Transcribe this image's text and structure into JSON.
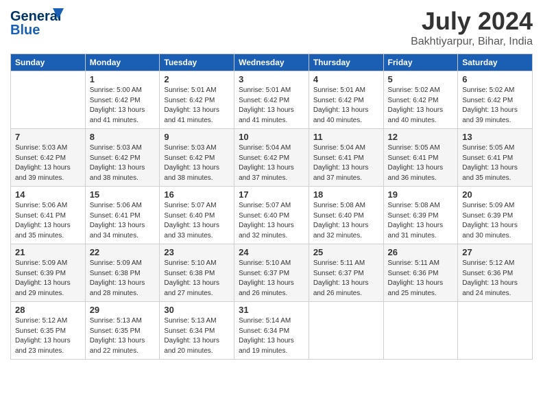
{
  "header": {
    "logo_line1": "General",
    "logo_line2": "Blue",
    "month_year": "July 2024",
    "location": "Bakhtiyarpur, Bihar, India"
  },
  "columns": [
    "Sunday",
    "Monday",
    "Tuesday",
    "Wednesday",
    "Thursday",
    "Friday",
    "Saturday"
  ],
  "weeks": [
    [
      {
        "day": "",
        "info": ""
      },
      {
        "day": "1",
        "info": "Sunrise: 5:00 AM\nSunset: 6:42 PM\nDaylight: 13 hours\nand 41 minutes."
      },
      {
        "day": "2",
        "info": "Sunrise: 5:01 AM\nSunset: 6:42 PM\nDaylight: 13 hours\nand 41 minutes."
      },
      {
        "day": "3",
        "info": "Sunrise: 5:01 AM\nSunset: 6:42 PM\nDaylight: 13 hours\nand 41 minutes."
      },
      {
        "day": "4",
        "info": "Sunrise: 5:01 AM\nSunset: 6:42 PM\nDaylight: 13 hours\nand 40 minutes."
      },
      {
        "day": "5",
        "info": "Sunrise: 5:02 AM\nSunset: 6:42 PM\nDaylight: 13 hours\nand 40 minutes."
      },
      {
        "day": "6",
        "info": "Sunrise: 5:02 AM\nSunset: 6:42 PM\nDaylight: 13 hours\nand 39 minutes."
      }
    ],
    [
      {
        "day": "7",
        "info": "Sunrise: 5:03 AM\nSunset: 6:42 PM\nDaylight: 13 hours\nand 39 minutes."
      },
      {
        "day": "8",
        "info": "Sunrise: 5:03 AM\nSunset: 6:42 PM\nDaylight: 13 hours\nand 38 minutes."
      },
      {
        "day": "9",
        "info": "Sunrise: 5:03 AM\nSunset: 6:42 PM\nDaylight: 13 hours\nand 38 minutes."
      },
      {
        "day": "10",
        "info": "Sunrise: 5:04 AM\nSunset: 6:42 PM\nDaylight: 13 hours\nand 37 minutes."
      },
      {
        "day": "11",
        "info": "Sunrise: 5:04 AM\nSunset: 6:41 PM\nDaylight: 13 hours\nand 37 minutes."
      },
      {
        "day": "12",
        "info": "Sunrise: 5:05 AM\nSunset: 6:41 PM\nDaylight: 13 hours\nand 36 minutes."
      },
      {
        "day": "13",
        "info": "Sunrise: 5:05 AM\nSunset: 6:41 PM\nDaylight: 13 hours\nand 35 minutes."
      }
    ],
    [
      {
        "day": "14",
        "info": "Sunrise: 5:06 AM\nSunset: 6:41 PM\nDaylight: 13 hours\nand 35 minutes."
      },
      {
        "day": "15",
        "info": "Sunrise: 5:06 AM\nSunset: 6:41 PM\nDaylight: 13 hours\nand 34 minutes."
      },
      {
        "day": "16",
        "info": "Sunrise: 5:07 AM\nSunset: 6:40 PM\nDaylight: 13 hours\nand 33 minutes."
      },
      {
        "day": "17",
        "info": "Sunrise: 5:07 AM\nSunset: 6:40 PM\nDaylight: 13 hours\nand 32 minutes."
      },
      {
        "day": "18",
        "info": "Sunrise: 5:08 AM\nSunset: 6:40 PM\nDaylight: 13 hours\nand 32 minutes."
      },
      {
        "day": "19",
        "info": "Sunrise: 5:08 AM\nSunset: 6:39 PM\nDaylight: 13 hours\nand 31 minutes."
      },
      {
        "day": "20",
        "info": "Sunrise: 5:09 AM\nSunset: 6:39 PM\nDaylight: 13 hours\nand 30 minutes."
      }
    ],
    [
      {
        "day": "21",
        "info": "Sunrise: 5:09 AM\nSunset: 6:39 PM\nDaylight: 13 hours\nand 29 minutes."
      },
      {
        "day": "22",
        "info": "Sunrise: 5:09 AM\nSunset: 6:38 PM\nDaylight: 13 hours\nand 28 minutes."
      },
      {
        "day": "23",
        "info": "Sunrise: 5:10 AM\nSunset: 6:38 PM\nDaylight: 13 hours\nand 27 minutes."
      },
      {
        "day": "24",
        "info": "Sunrise: 5:10 AM\nSunset: 6:37 PM\nDaylight: 13 hours\nand 26 minutes."
      },
      {
        "day": "25",
        "info": "Sunrise: 5:11 AM\nSunset: 6:37 PM\nDaylight: 13 hours\nand 26 minutes."
      },
      {
        "day": "26",
        "info": "Sunrise: 5:11 AM\nSunset: 6:36 PM\nDaylight: 13 hours\nand 25 minutes."
      },
      {
        "day": "27",
        "info": "Sunrise: 5:12 AM\nSunset: 6:36 PM\nDaylight: 13 hours\nand 24 minutes."
      }
    ],
    [
      {
        "day": "28",
        "info": "Sunrise: 5:12 AM\nSunset: 6:35 PM\nDaylight: 13 hours\nand 23 minutes."
      },
      {
        "day": "29",
        "info": "Sunrise: 5:13 AM\nSunset: 6:35 PM\nDaylight: 13 hours\nand 22 minutes."
      },
      {
        "day": "30",
        "info": "Sunrise: 5:13 AM\nSunset: 6:34 PM\nDaylight: 13 hours\nand 20 minutes."
      },
      {
        "day": "31",
        "info": "Sunrise: 5:14 AM\nSunset: 6:34 PM\nDaylight: 13 hours\nand 19 minutes."
      },
      {
        "day": "",
        "info": ""
      },
      {
        "day": "",
        "info": ""
      },
      {
        "day": "",
        "info": ""
      }
    ]
  ]
}
